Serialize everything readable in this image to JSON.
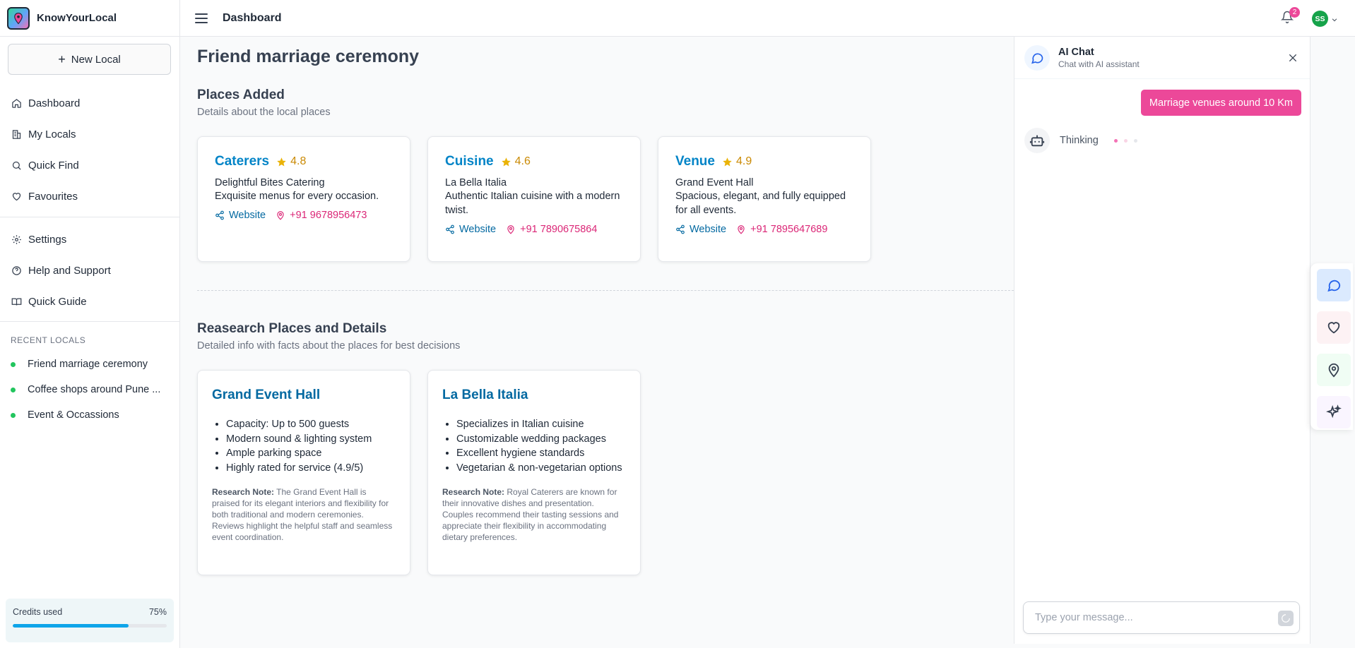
{
  "app": {
    "name": "KnowYourLocal"
  },
  "sidebar": {
    "new_local_label": "New Local",
    "nav_primary": [
      {
        "label": "Dashboard",
        "icon": "home-icon"
      },
      {
        "label": "My Locals",
        "icon": "building-icon"
      },
      {
        "label": "Quick Find",
        "icon": "search-icon"
      },
      {
        "label": "Favourites",
        "icon": "heart-icon"
      }
    ],
    "nav_secondary": [
      {
        "label": "Settings",
        "icon": "gear-icon"
      },
      {
        "label": "Help and Support",
        "icon": "help-circle-icon"
      },
      {
        "label": "Quick Guide",
        "icon": "book-icon"
      }
    ],
    "recent_title": "RECENT LOCALS",
    "recent": [
      {
        "label": "Friend marriage ceremony"
      },
      {
        "label": "Coffee shops around Pune ..."
      },
      {
        "label": "Event & Occassions"
      }
    ],
    "credits": {
      "label": "Credits used",
      "value_label": "75%",
      "fraction": 0.75
    }
  },
  "topbar": {
    "title": "Dashboard",
    "notification_count": "2",
    "avatar_initials": "SS"
  },
  "main": {
    "page_title": "Friend marriage ceremony",
    "places_section": {
      "title": "Places Added",
      "subtitle": "Details about the local places",
      "cards": [
        {
          "category": "Caterers",
          "rating": "4.8",
          "name": "Delightful Bites Catering",
          "description": "Exquisite menus for every occasion.",
          "website_label": "Website",
          "phone": "+91 9678956473"
        },
        {
          "category": "Cuisine",
          "rating": "4.6",
          "name": "La Bella Italia",
          "description": "Authentic Italian cuisine with a modern twist.",
          "website_label": "Website",
          "phone": "+91 7890675864"
        },
        {
          "category": "Venue",
          "rating": "4.9",
          "name": "Grand Event Hall",
          "description": "Spacious, elegant, and fully equipped for all events.",
          "website_label": "Website",
          "phone": "+91 7895647689"
        }
      ]
    },
    "research_section": {
      "title": "Reasearch Places and Details",
      "subtitle": "Detailed info with facts about the places for best decisions",
      "cards": [
        {
          "title": "Grand Event Hall",
          "bullets": [
            "Capacity: Up to 500 guests",
            "Modern sound & lighting system",
            "Ample parking space",
            "Highly rated for service (4.9/5)"
          ],
          "note_label": "Research Note:",
          "note": "The Grand Event Hall is praised for its elegant interiors and flexibility for both traditional and modern ceremonies. Reviews highlight the helpful staff and seamless event coordination."
        },
        {
          "title": "La Bella Italia",
          "bullets": [
            "Specializes in Italian cuisine",
            "Customizable wedding packages",
            "Excellent hygiene standards",
            "Vegetarian & non-vegetarian options"
          ],
          "note_label": "Research Note:",
          "note": "Royal Caterers are known for their innovative dishes and presentation. Couples recommend their tasting sessions and appreciate their flexibility in accommodating dietary preferences."
        }
      ]
    }
  },
  "chat": {
    "title": "AI Chat",
    "subtitle": "Chat with AI assistant",
    "user_message": "Marriage venues around 10 Km",
    "thinking_label": "Thinking",
    "input_placeholder": "Type your message..."
  },
  "rail": [
    {
      "icon": "chat-bubble-icon",
      "bg": "#dbeafe",
      "color": "#2563eb"
    },
    {
      "icon": "heart-icon",
      "bg": "#fdf2f4",
      "color": "#374151"
    },
    {
      "icon": "map-pin-icon",
      "bg": "#f0fdf4",
      "color": "#374151"
    },
    {
      "icon": "sparkles-icon",
      "bg": "#faf5ff",
      "color": "#374151"
    }
  ],
  "colors": {
    "accent_blue": "#0284c7",
    "accent_pink": "#ec4899",
    "star": "#eab308",
    "recent_dot": "#22c55e"
  }
}
